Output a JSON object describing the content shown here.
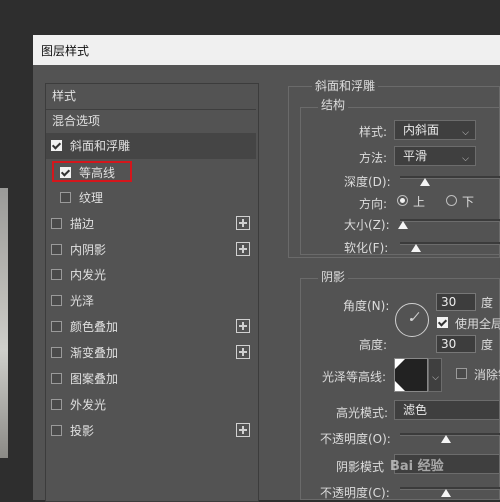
{
  "title": "图层样式",
  "left_items": [
    {
      "label": "样式",
      "checkbox": false,
      "checked": false,
      "plus": false
    },
    {
      "label": "混合选项",
      "checkbox": false,
      "checked": false,
      "plus": false
    },
    {
      "label": "斜面和浮雕",
      "checkbox": true,
      "checked": true,
      "plus": false
    },
    {
      "label": "等高线",
      "checkbox": true,
      "checked": true,
      "plus": false
    },
    {
      "label": "纹理",
      "checkbox": true,
      "checked": false,
      "plus": false
    },
    {
      "label": "描边",
      "checkbox": true,
      "checked": false,
      "plus": true
    },
    {
      "label": "内阴影",
      "checkbox": true,
      "checked": false,
      "plus": true
    },
    {
      "label": "内发光",
      "checkbox": true,
      "checked": false,
      "plus": false
    },
    {
      "label": "光泽",
      "checkbox": true,
      "checked": false,
      "plus": false
    },
    {
      "label": "颜色叠加",
      "checkbox": true,
      "checked": false,
      "plus": true
    },
    {
      "label": "渐变叠加",
      "checkbox": true,
      "checked": false,
      "plus": true
    },
    {
      "label": "图案叠加",
      "checkbox": true,
      "checked": false,
      "plus": false
    },
    {
      "label": "外发光",
      "checkbox": true,
      "checked": false,
      "plus": false
    },
    {
      "label": "投影",
      "checkbox": true,
      "checked": false,
      "plus": true
    }
  ],
  "bevel": {
    "section_title": "斜面和浮雕",
    "structure_title": "结构",
    "style_label": "样式:",
    "style_value": "内斜面",
    "method_label": "方法:",
    "method_value": "平滑",
    "depth_label": "深度(D):",
    "direction_label": "方向:",
    "dir_up": "上",
    "dir_down": "下",
    "size_label": "大小(Z):",
    "soften_label": "软化(F):"
  },
  "shading": {
    "title": "阴影",
    "angle_label": "角度(N):",
    "angle_value": "30",
    "angle_unit": "度",
    "global_light": "使用全局",
    "altitude_label": "高度:",
    "altitude_value": "30",
    "altitude_unit": "度",
    "gloss_label": "光泽等高线:",
    "antialias": "消除锯",
    "highlight_mode_label": "高光模式:",
    "highlight_mode_value": "滤色",
    "opacity1_label": "不透明度(O):",
    "shadow_mode_label": "阴影模式",
    "opacity2_label": "不透明度(C):"
  },
  "watermark": "Bai 经验"
}
